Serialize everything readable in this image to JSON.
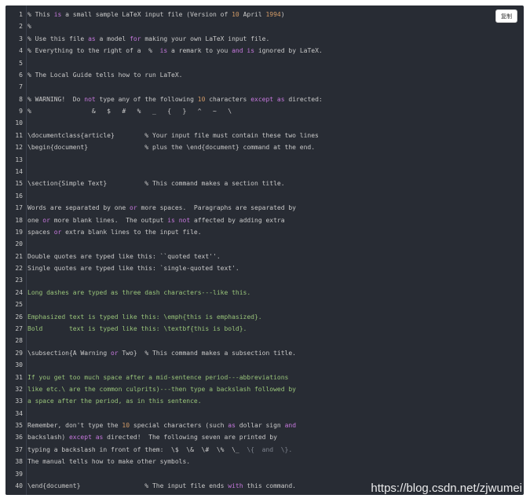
{
  "copy_button": {
    "label": "复制"
  },
  "watermark": {
    "text": "https://blog.csdn.net/zjwumei"
  },
  "code": {
    "language": "latex",
    "lines": [
      {
        "n": "1",
        "t": "% This is a small sample LaTeX input file (Version of 10 April 1994)"
      },
      {
        "n": "2",
        "t": "%"
      },
      {
        "n": "3",
        "t": "% Use this file as a model for making your own LaTeX input file."
      },
      {
        "n": "4",
        "t": "% Everything to the right of a  %  is a remark to you and is ignored by LaTeX."
      },
      {
        "n": "5",
        "t": ""
      },
      {
        "n": "6",
        "t": "% The Local Guide tells how to run LaTeX."
      },
      {
        "n": "7",
        "t": ""
      },
      {
        "n": "8",
        "t": "% WARNING!  Do not type any of the following 10 characters except as directed:"
      },
      {
        "n": "9",
        "t": "%                &   $   #   %   _   {   }   ^   ~   \\"
      },
      {
        "n": "10",
        "t": ""
      },
      {
        "n": "11",
        "t": "\\documentclass{article}        % Your input file must contain these two lines"
      },
      {
        "n": "12",
        "t": "\\begin{document}               % plus the \\end{document} command at the end."
      },
      {
        "n": "13",
        "t": ""
      },
      {
        "n": "14",
        "t": ""
      },
      {
        "n": "15",
        "t": "\\section{Simple Text}          % This command makes a section title."
      },
      {
        "n": "16",
        "t": ""
      },
      {
        "n": "17",
        "t": "Words are separated by one or more spaces.  Paragraphs are separated by"
      },
      {
        "n": "18",
        "t": "one or more blank lines.  The output is not affected by adding extra"
      },
      {
        "n": "19",
        "t": "spaces or extra blank lines to the input file."
      },
      {
        "n": "20",
        "t": ""
      },
      {
        "n": "21",
        "t": "Double quotes are typed like this: ``quoted text''."
      },
      {
        "n": "22",
        "t": "Single quotes are typed like this: `single-quoted text'."
      },
      {
        "n": "23",
        "t": ""
      },
      {
        "n": "24",
        "t": "Long dashes are typed as three dash characters---like this."
      },
      {
        "n": "25",
        "t": ""
      },
      {
        "n": "26",
        "t": "Emphasized text is typed like this: \\emph{this is emphasized}."
      },
      {
        "n": "27",
        "t": "Bold       text is typed like this: \\textbf{this is bold}."
      },
      {
        "n": "28",
        "t": ""
      },
      {
        "n": "29",
        "t": "\\subsection{A Warning or Two}  % This command makes a subsection title."
      },
      {
        "n": "30",
        "t": ""
      },
      {
        "n": "31",
        "t": "If you get too much space after a mid-sentence period---abbreviations"
      },
      {
        "n": "32",
        "t": "like etc.\\ are the common culprits)---then type a backslash followed by"
      },
      {
        "n": "33",
        "t": "a space after the period, as in this sentence."
      },
      {
        "n": "34",
        "t": ""
      },
      {
        "n": "35",
        "t": "Remember, don't type the 10 special characters (such as dollar sign and"
      },
      {
        "n": "36",
        "t": "backslash) except as directed!  The following seven are printed by"
      },
      {
        "n": "37",
        "t": "typing a backslash in front of them:  \\$  \\&  \\#  \\%  \\_  \\{  and  \\}."
      },
      {
        "n": "38",
        "t": "The manual tells how to make other symbols."
      },
      {
        "n": "39",
        "t": ""
      },
      {
        "n": "40",
        "t": "\\end{document}                 % The input file ends with this command."
      }
    ]
  }
}
